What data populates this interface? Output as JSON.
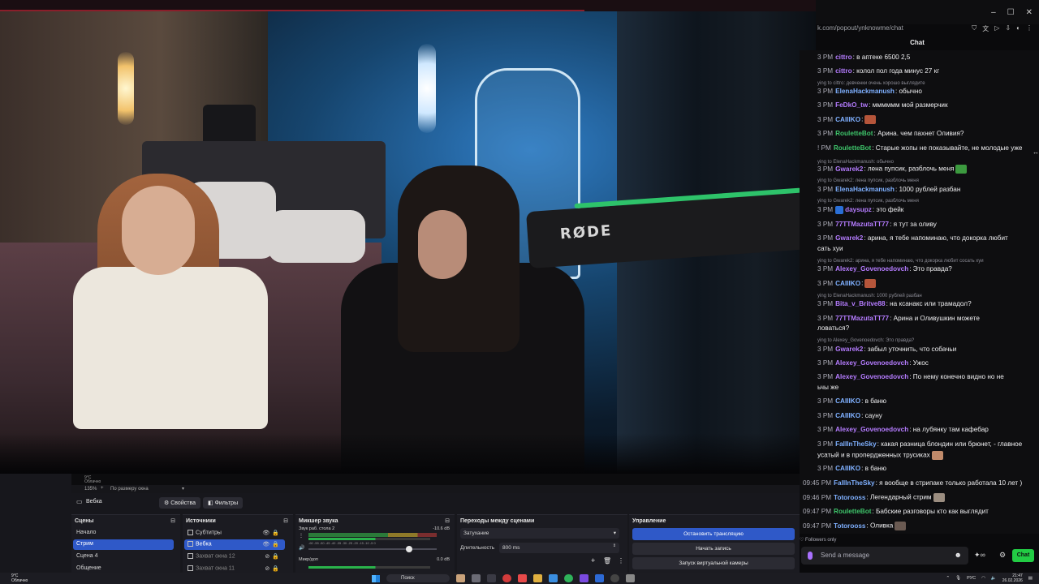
{
  "browser": {
    "url": "k.com/popout/ynknowme/chat",
    "chat_title": "Chat",
    "window_controls": [
      "–",
      "☐",
      "✕"
    ],
    "scroll_arrow": "↔"
  },
  "chat": {
    "messages": [
      {
        "ts": "3 PM",
        "user": "cittro",
        "color": "#b57cff",
        "text": ": в аптеке 6500 2,5",
        "top": 0
      },
      {
        "ts": "3 PM",
        "user": "cittro",
        "color": "#b57cff",
        "text": ": колол пол года минус 27 кг",
        "top": 0
      },
      {
        "reply": "ying to cittro: девченки очень хорошо выглядите"
      },
      {
        "ts": "3 PM",
        "user": "ElenaHackmanush",
        "color": "#7fb0ff",
        "text": ": обычно"
      },
      {
        "ts": "3 PM",
        "user": "FeDkO_tw",
        "color": "#b57cff",
        "text": ": мммммм мой размерчик"
      },
      {
        "ts": "3 PM",
        "user": "CAIIIKO",
        "color": "#7fb0ff",
        "text": ":",
        "emote": "#b5553a"
      },
      {
        "ts": "3 PM",
        "user": "RouletteBot",
        "color": "#3ec46a",
        "text": ": Арина. чем пахнет Оливия?"
      },
      {
        "ts": "! PM",
        "user": "RouletteBot",
        "color": "#3ec46a",
        "text": ": Старые жопы не показывайте, не молодые уже"
      },
      {
        "reply": "ying to ElenaHackmanush: обычно"
      },
      {
        "ts": "3 PM",
        "user": "Gwarek2",
        "color": "#b57cff",
        "text": ": лена пупсик, разблочь меня",
        "emote": "#3c9a3f"
      },
      {
        "reply": "ying to Gwarek2: лена пупсик, разблочь меня"
      },
      {
        "ts": "3 PM",
        "user": "ElenaHackmanush",
        "color": "#7fb0ff",
        "text": ": 1000 рублей разбан"
      },
      {
        "reply": "ying to Gwarek2: лена пупсик, разблочь меня"
      },
      {
        "ts": "3 PM",
        "user": "daysupz",
        "color": "#b57cff",
        "text": ": это фейк",
        "bits": true
      },
      {
        "ts": "3 PM",
        "user": "77TTMazutaTT77",
        "color": "#b57cff",
        "text": ": я тут за оливу"
      },
      {
        "ts": "3 PM",
        "user": "Gwarek2",
        "color": "#b57cff",
        "text": ": арина, я тебе напоминаю, что докорка любит"
      },
      {
        "cont": "сать хуи"
      },
      {
        "reply": "ying to Gwarek2: арина, я тебе напоминаю, что докорка любит сосать хуи"
      },
      {
        "ts": "3 PM",
        "user": "Alexey_Govenoedovch",
        "color": "#b57cff",
        "text": ": Это правда?"
      },
      {
        "ts": "3 PM",
        "user": "CAIIIKO",
        "color": "#7fb0ff",
        "text": ":",
        "emote": "#b5553a"
      },
      {
        "reply": "ying to ElenaHackmanush: 1000 рублей разбан"
      },
      {
        "ts": "3 PM",
        "user": "Bita_v_Britve88",
        "color": "#b57cff",
        "text": ": на ксанакс или трамадол?"
      },
      {
        "ts": "3 PM",
        "user": "77TTMazutaTT77",
        "color": "#b57cff",
        "text": ": Арина и Оливушкин можете"
      },
      {
        "cont": "ловаться?"
      },
      {
        "reply": "ying to Alexey_Govenoedovch: Это правда?"
      },
      {
        "ts": "3 PM",
        "user": "Gwarek2",
        "color": "#b57cff",
        "text": ": забыл уточнить, что собачьи"
      },
      {
        "ts": "3 PM",
        "user": "Alexey_Govenoedovch",
        "color": "#b57cff",
        "text": ": Ужос"
      },
      {
        "ts": "3 PM",
        "user": "Alexey_Govenoedovch",
        "color": "#b57cff",
        "text": ": По нему конечно видно но не"
      },
      {
        "cont": "ьчы же"
      },
      {
        "ts": "3 PM",
        "user": "CAIIIKO",
        "color": "#7fb0ff",
        "text": ": в баню"
      },
      {
        "ts": "3 PM",
        "user": "CAIIIKO",
        "color": "#7fb0ff",
        "text": ": сауну"
      },
      {
        "ts": "3 PM",
        "user": "Alexey_Govenoedovch",
        "color": "#b57cff",
        "text": ": на лубянку там кафебар"
      },
      {
        "ts": "3 PM",
        "user": "FallInTheSky",
        "color": "#7fb0ff",
        "text": ": какая разница блондин или брюнет, - главное"
      },
      {
        "cont": "усатый и в пропердженных трусиках",
        "emote": "#c08a6a"
      },
      {
        "ts": "3 PM",
        "user": "CAIIIKO",
        "color": "#7fb0ff",
        "text": ": в баню"
      },
      {
        "ts": "09:45 PM",
        "user": "FallInTheSky",
        "color": "#7fb0ff",
        "text": ": я вообще в стрипаке только работала 10 лет )"
      },
      {
        "ts": "09:46 PM",
        "user": "Totorooss",
        "color": "#7fb0ff",
        "text": ": Легендарный стрим",
        "emote": "#9b8d80"
      },
      {
        "ts": "09:47 PM",
        "user": "RouletteBot",
        "color": "#3ec46a",
        "text": ": Бабские разговоры кто как выглядит"
      },
      {
        "ts": "09:47 PM",
        "user": "Totorooss",
        "color": "#7fb0ff",
        "text": ": Оливка",
        "emote": "#6a5a52"
      }
    ],
    "followers_only": "Followers only",
    "input_placeholder": "Send a message",
    "chat_button": "Chat"
  },
  "obs": {
    "top_info_1": "9°C",
    "top_info_2": "Облачно",
    "zoom_label": "135%",
    "fit_label": "По размеру окна",
    "source_name": "Вебка",
    "properties_btn": "Свойства",
    "filters_btn": "Фильтры",
    "panels": {
      "scenes": {
        "title": "Сцены",
        "items": [
          "Начало",
          "Стрим",
          "Сцена 4",
          "Общение"
        ],
        "selected": 1
      },
      "sources": {
        "title": "Источники",
        "items": [
          "Субтитры",
          "Вебка",
          "Захват окна 12",
          "Захват окна 11"
        ],
        "selected": 1
      },
      "mixer": {
        "title": "Микшер звука",
        "tracks": [
          {
            "name": "Звук раб. стола 2",
            "db": "-10.6 dB"
          },
          {
            "name": "Микр/доп",
            "db": "0.0 dB"
          }
        ],
        "scale": "-60 -55 -50 -45 -40 -35 -30 -25 -20 -15 -10 -5 0"
      },
      "transitions": {
        "title": "Переходы между сценами",
        "transition": "Затухание",
        "duration_label": "Длительность",
        "duration_value": "800 ms"
      },
      "controls": {
        "title": "Управление",
        "buttons": [
          "Остановить трансляцию",
          "Начать запись",
          "Запуск виртуальной камеры"
        ]
      }
    }
  },
  "taskbar": {
    "weather_temp": "9°C",
    "weather_desc": "Облачно",
    "search_label": "Поиск",
    "lang": "РУС",
    "time": "21:47",
    "date": "26.02.2026"
  },
  "video": {
    "mic_brand": "RØDE"
  }
}
